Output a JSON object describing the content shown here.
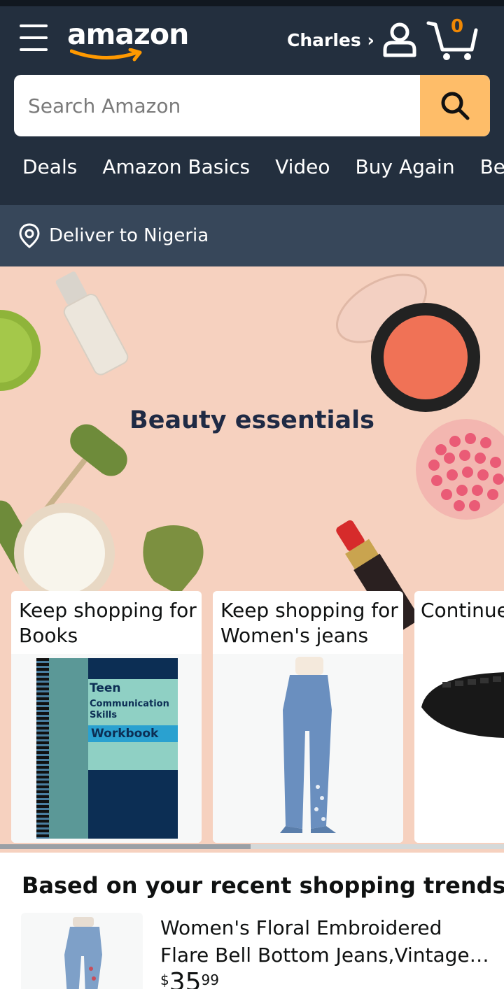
{
  "header": {
    "logo_text": "amazon",
    "account_label": "Charles ›",
    "cart_count": "0"
  },
  "search": {
    "placeholder": "Search Amazon"
  },
  "nav": {
    "items": [
      "Deals",
      "Amazon Basics",
      "Video",
      "Buy Again",
      "Best"
    ]
  },
  "deliver": {
    "label": "Deliver to Nigeria"
  },
  "hero": {
    "title": "Beauty essentials"
  },
  "cards": [
    {
      "title": "Keep shopping for Books"
    },
    {
      "title": "Keep shopping for Women's jeans"
    },
    {
      "title": "Continue"
    }
  ],
  "book": {
    "cover_title": "Teen",
    "cover_subtitle": "Communication Skills",
    "cover_label": "Workbook"
  },
  "trends": {
    "title": "Based on your recent shopping trends",
    "item": {
      "name": "Women's Floral Embroidered Flare Bell Bottom Jeans,Vintage-Inspi…",
      "price_currency": "$",
      "price_whole": "35",
      "price_fraction": "99"
    }
  },
  "colors": {
    "header_bg": "#232f3e",
    "deliver_bg": "#37475a",
    "search_button": "#febd69",
    "cart_count": "#f08804",
    "hero_bg": "#f6d1bf"
  }
}
